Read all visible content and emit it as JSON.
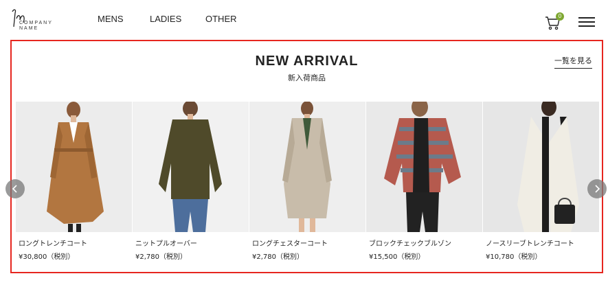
{
  "brand": {
    "logo_text_1": "COMPANY",
    "logo_text_2": "NAME"
  },
  "nav": {
    "mens": "MENS",
    "ladies": "LADIES",
    "other": "OTHER"
  },
  "cart": {
    "count": "0",
    "badge_color": "#7fa832"
  },
  "section": {
    "title": "NEW ARRIVAL",
    "subtitle": "新入荷商品",
    "view_all": "一覧を見る",
    "border_color": "#e6261f"
  },
  "products": [
    {
      "name": "ロングトレンチコート",
      "price": "¥30,800（税別）",
      "bg": "#ececec",
      "garment": "#b27640",
      "icon": "long-trench-coat-photo"
    },
    {
      "name": "ニットプルオーバー",
      "price": "¥2,780（税別）",
      "bg": "#f1f1f1",
      "garment": "#4f4a2a",
      "icon": "knit-pullover-photo"
    },
    {
      "name": "ロングチェスターコート",
      "price": "¥2,780（税別）",
      "bg": "#eeeeee",
      "garment": "#c8bcaa",
      "icon": "long-chester-coat-photo"
    },
    {
      "name": "ブロックチェックブルゾン",
      "price": "¥15,500（税別）",
      "bg": "#e9e9e9",
      "garment": "#b55a4e",
      "icon": "block-check-blouson-photo"
    },
    {
      "name": "ノースリーブトレンチコート",
      "price": "¥10,780（税別）",
      "bg": "#e6e6e6",
      "garment": "#f0ede4",
      "icon": "sleeveless-trench-coat-photo"
    }
  ]
}
